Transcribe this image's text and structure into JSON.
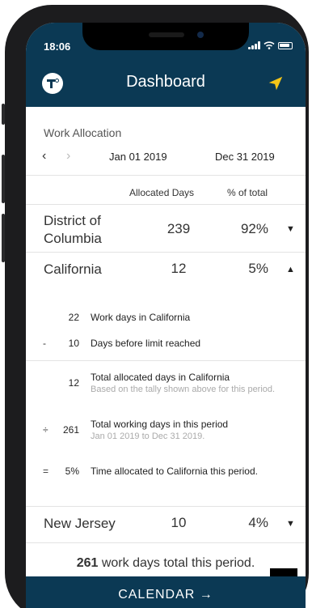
{
  "status_bar": {
    "time": "18:06"
  },
  "header": {
    "title": "Dashboard",
    "logo_icon": "tally-logo-icon",
    "nav_icon": "location-arrow-icon"
  },
  "colors": {
    "header_bg": "#0b3954",
    "nav_icon": "#f5c518"
  },
  "allocation": {
    "title": "Work Allocation",
    "prev_arrow": "‹",
    "next_arrow": "›",
    "start_date": "Jan 01 2019",
    "end_date": "Dec 31 2019",
    "col_days": "Allocated Days",
    "col_pct": "% of total"
  },
  "states": [
    {
      "name_line1": "District of",
      "name_line2": "Columbia",
      "days": "239",
      "pct": "92%",
      "toggle": "▼"
    },
    {
      "name": "California",
      "days": "12",
      "pct": "5%",
      "toggle": "▲"
    },
    {
      "name": "New Jersey",
      "days": "10",
      "pct": "4%",
      "toggle": "▼"
    }
  ],
  "california_detail": {
    "row1": {
      "op": "",
      "num": "22",
      "label": "Work days in California"
    },
    "row2": {
      "op": "-",
      "num": "10",
      "label": "Days before limit reached"
    },
    "row3": {
      "op": "",
      "num": "12",
      "label": "Total allocated days in California",
      "sub": "Based on the tally shown above for this period."
    },
    "row4": {
      "op": "÷",
      "num": "261",
      "label": "Total working days in this period",
      "sub": "Jan 01 2019 to Dec 31 2019."
    },
    "row5": {
      "op": "=",
      "num": "5%",
      "label": "Time allocated to California this period."
    }
  },
  "summary": {
    "count": "261",
    "text": " work days total this period."
  },
  "calendar_button": {
    "label": "CALENDAR →"
  }
}
